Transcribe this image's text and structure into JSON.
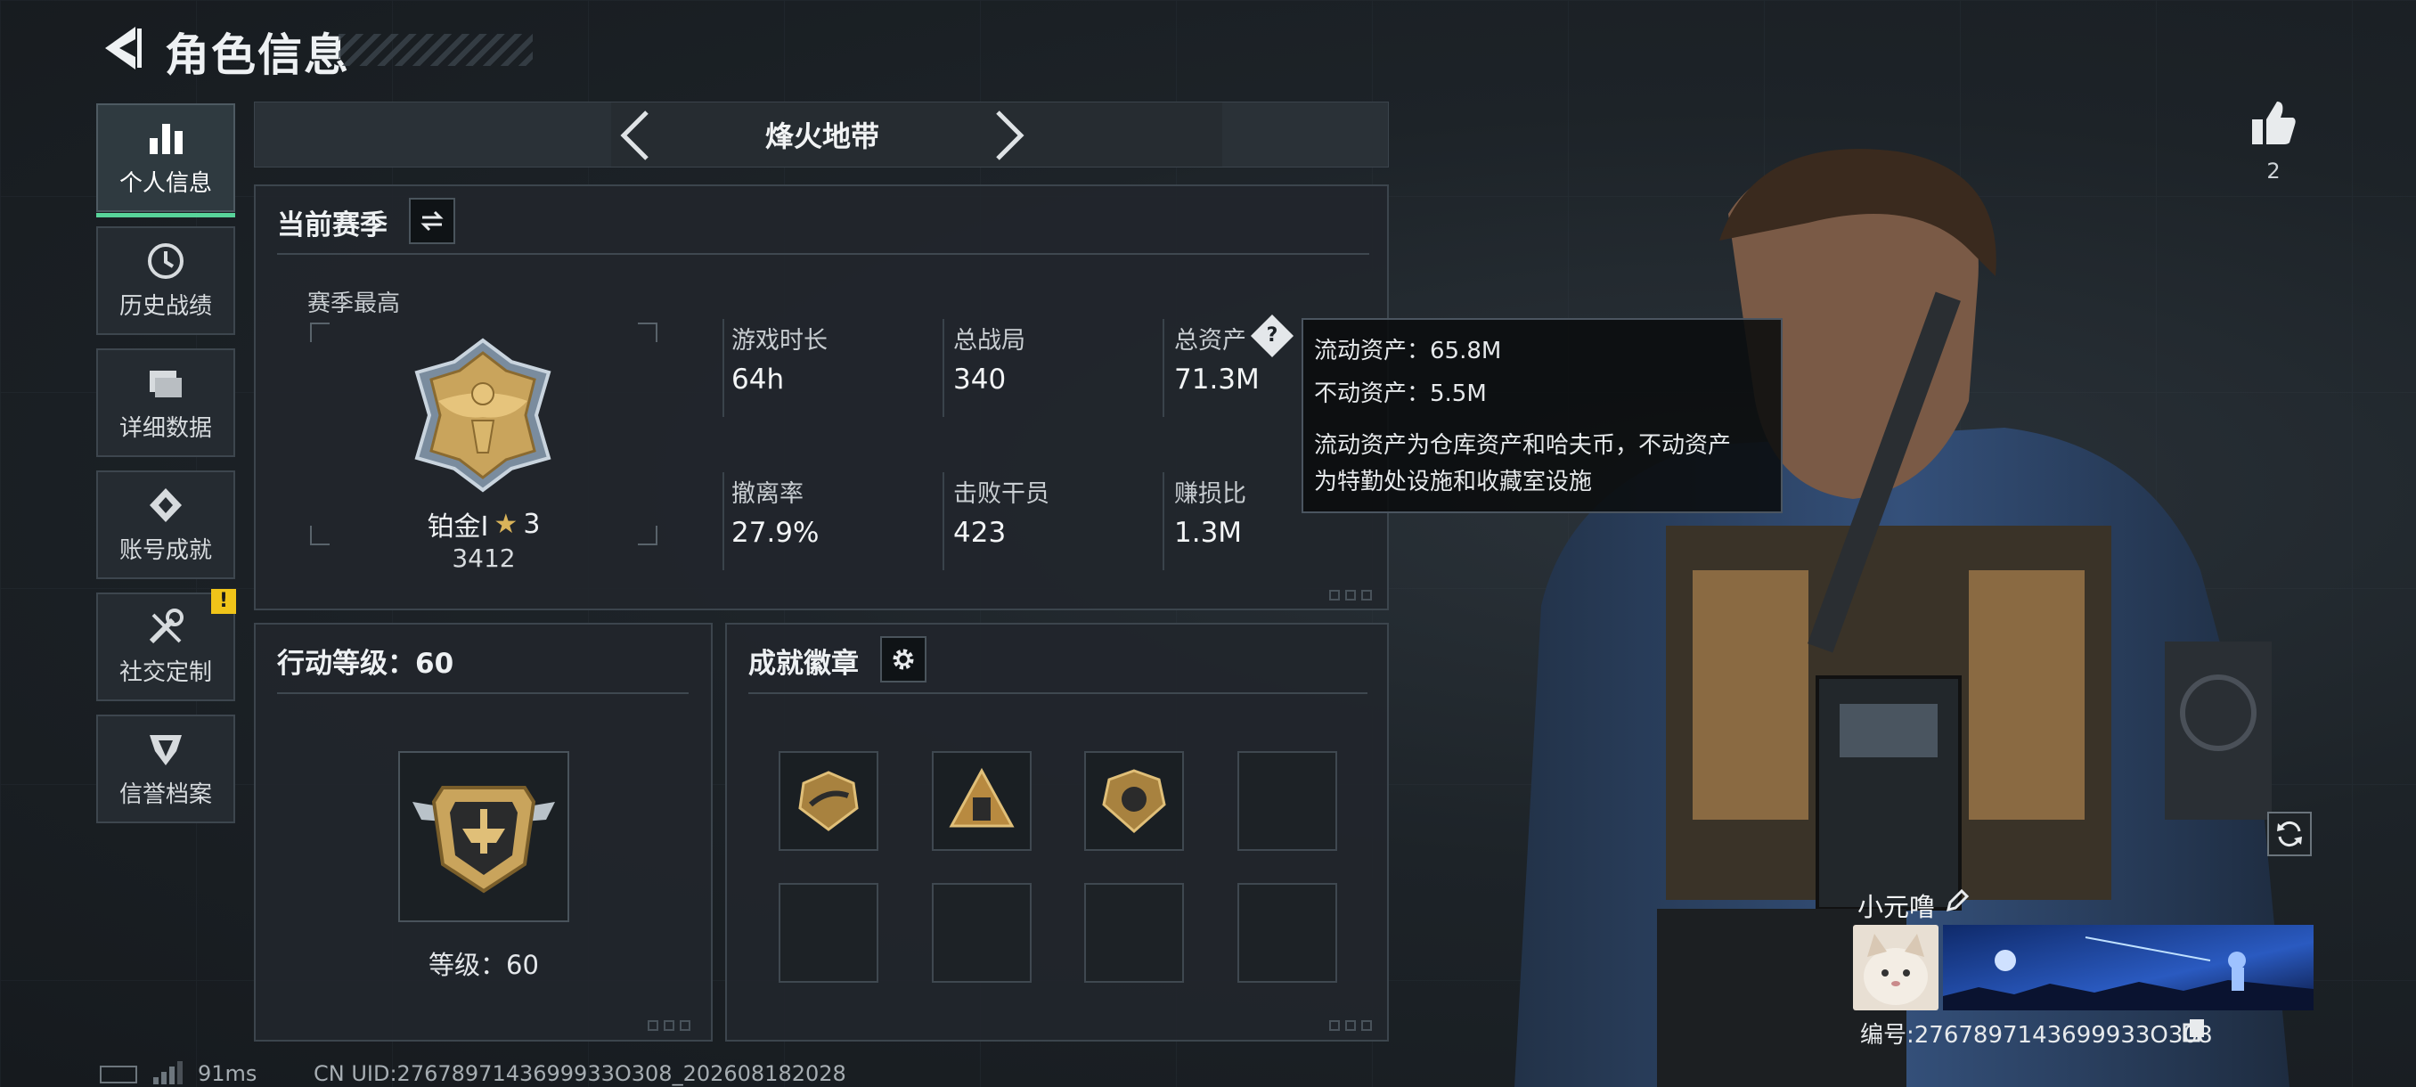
{
  "header": {
    "title": "角色信息"
  },
  "sidebar": {
    "items": [
      {
        "label": "个人信息",
        "icon": "bar-chart-icon",
        "active": true
      },
      {
        "label": "历史战绩",
        "icon": "clock-icon",
        "active": false
      },
      {
        "label": "详细数据",
        "icon": "folder-icon",
        "active": false
      },
      {
        "label": "账号成就",
        "icon": "achievement-icon",
        "active": false
      },
      {
        "label": "社交定制",
        "icon": "wrench-screwdriver-icon",
        "active": false,
        "alert": "!"
      },
      {
        "label": "信誉档案",
        "icon": "reputation-icon",
        "active": false
      }
    ]
  },
  "mode": {
    "label": "烽火地带"
  },
  "season": {
    "title": "当前赛季",
    "best_label": "赛季最高",
    "rank_name": "铂金Ⅰ",
    "rank_stars": "3",
    "rank_points": "3412",
    "stats": [
      {
        "label": "游戏时长",
        "value": "64h"
      },
      {
        "label": "总战局",
        "value": "340"
      },
      {
        "label": "总资产",
        "value": "71.3M",
        "help": "?"
      },
      {
        "label": "撤离率",
        "value": "27.9%"
      },
      {
        "label": "击败干员",
        "value": "423"
      },
      {
        "label": "赚损比",
        "value": "1.3M"
      }
    ]
  },
  "tooltip": {
    "liquid": "流动资产：65.8M",
    "fixed": "不动资产：5.5M",
    "desc_line1": "流动资产为仓库资产和哈夫币，不动资产",
    "desc_line2": "为特勤处设施和收藏室设施"
  },
  "level": {
    "title": "行动等级：60",
    "caption": "等级：60"
  },
  "badges": {
    "title": "成就徽章",
    "filled": 3,
    "total": 8
  },
  "player": {
    "likes": "2",
    "name": "小元噜",
    "id_text": "编号:2767897143699933O308"
  },
  "footer": {
    "ping": "91ms",
    "uid": "CN UID:2767897143699933O308_202608182028"
  },
  "colors": {
    "accent_green": "#58d39a",
    "alert_yellow": "#f0c419",
    "gold": "#c9a45c"
  }
}
